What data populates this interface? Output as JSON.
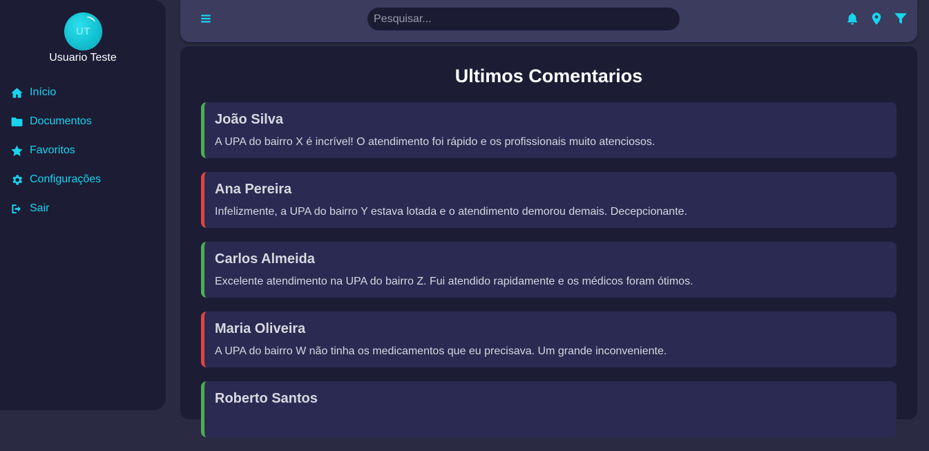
{
  "user": {
    "initials": "UT",
    "name": "Usuario Teste"
  },
  "nav": [
    {
      "label": "Início",
      "icon": "home-icon"
    },
    {
      "label": "Documentos",
      "icon": "folder-icon"
    },
    {
      "label": "Favoritos",
      "icon": "star-icon"
    },
    {
      "label": "Configurações",
      "icon": "gear-icon"
    },
    {
      "label": "Sair",
      "icon": "sign-out-icon"
    }
  ],
  "topbar": {
    "menu_icon": "hamburger-menu-icon",
    "search_placeholder": "Pesquisar...",
    "search_value": "",
    "icons": [
      "bell-icon",
      "map-pin-icon",
      "filter-icon"
    ]
  },
  "page_title": "Ultimos Comentarios",
  "comments": [
    {
      "author": "João Silva",
      "text": "A UPA do bairro X é incrível! O atendimento foi rápido e os profissionais muito atenciosos.",
      "sentiment": "positive"
    },
    {
      "author": "Ana Pereira",
      "text": "Infelizmente, a UPA do bairro Y estava lotada e o atendimento demorou demais. Decepcionante.",
      "sentiment": "negative"
    },
    {
      "author": "Carlos Almeida",
      "text": "Excelente atendimento na UPA do bairro Z. Fui atendido rapidamente e os médicos foram ótimos.",
      "sentiment": "positive"
    },
    {
      "author": "Maria Oliveira",
      "text": "A UPA do bairro W não tinha os medicamentos que eu precisava. Um grande inconveniente.",
      "sentiment": "negative"
    },
    {
      "author": "Roberto Santos",
      "text": "",
      "sentiment": "positive"
    }
  ],
  "colors": {
    "accent": "#18d4ee",
    "sidebar_bg": "#1c1c35",
    "topbar_bg": "#3b3c5e",
    "card_bg": "#2a2a52",
    "positive": "#4caf50",
    "negative": "#e04444"
  }
}
